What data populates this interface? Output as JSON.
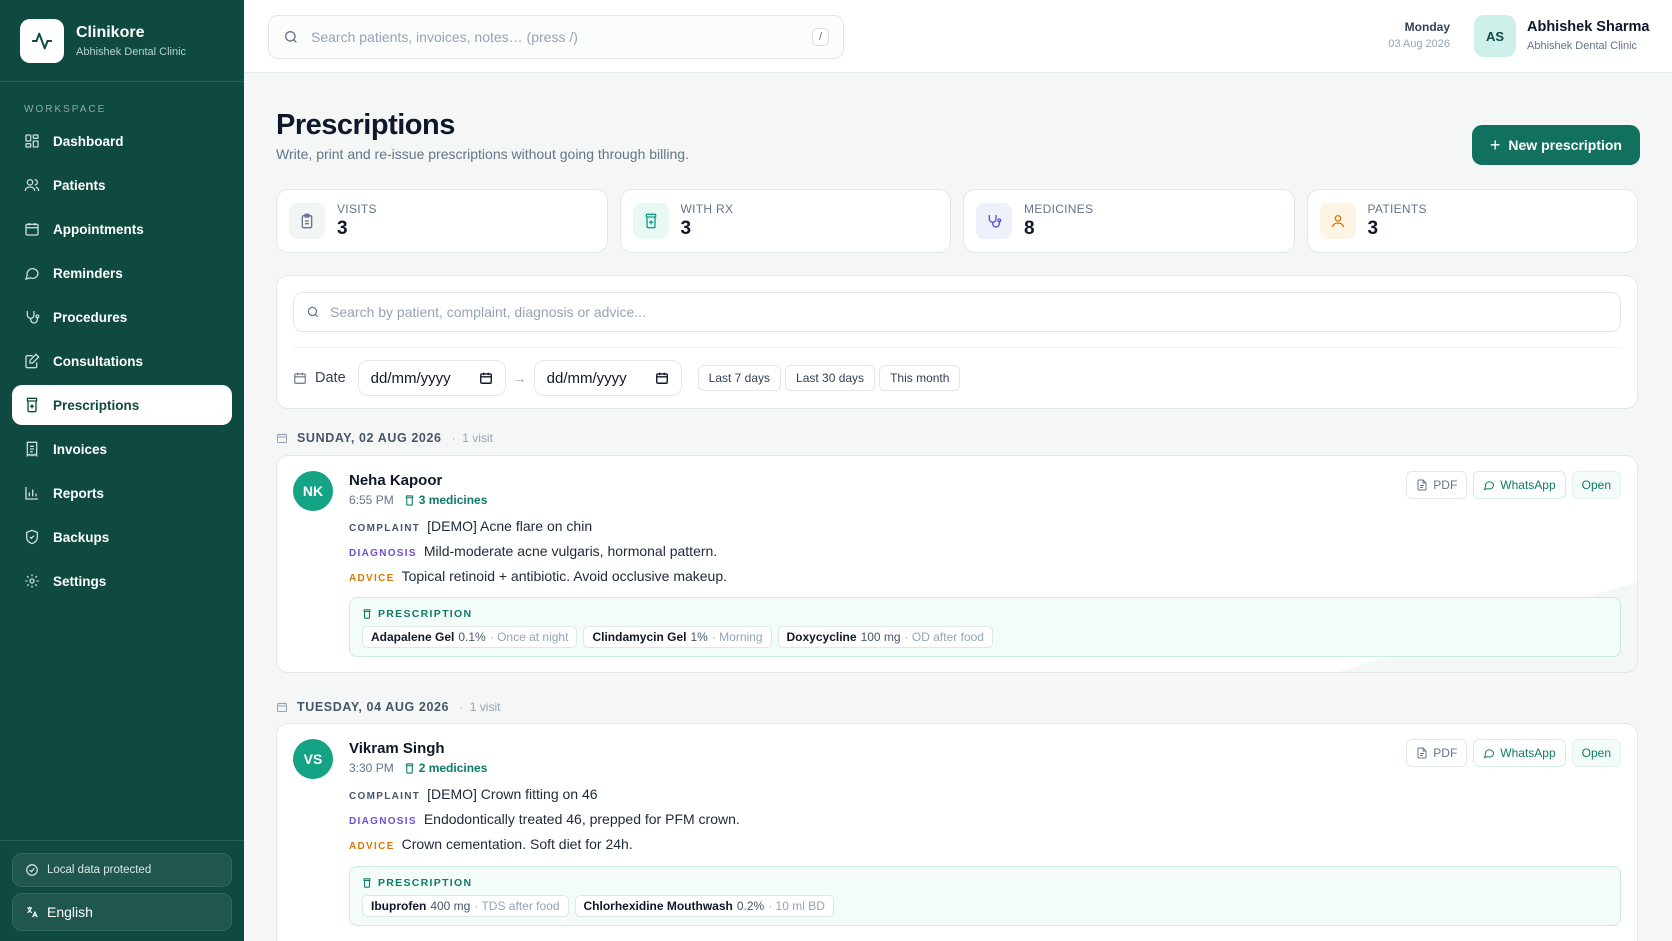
{
  "app": {
    "name": "Clinikore",
    "clinic": "Abhishek Dental Clinic"
  },
  "sidebar": {
    "section_label": "WORKSPACE",
    "items": [
      {
        "label": "Dashboard",
        "icon": "dashboard-icon"
      },
      {
        "label": "Patients",
        "icon": "users-icon"
      },
      {
        "label": "Appointments",
        "icon": "calendar-icon"
      },
      {
        "label": "Reminders",
        "icon": "message-icon"
      },
      {
        "label": "Procedures",
        "icon": "stethoscope-icon"
      },
      {
        "label": "Consultations",
        "icon": "clipboard-edit-icon"
      },
      {
        "label": "Prescriptions",
        "icon": "bottle-icon",
        "active": true
      },
      {
        "label": "Invoices",
        "icon": "receipt-icon"
      },
      {
        "label": "Reports",
        "icon": "bar-chart-icon"
      },
      {
        "label": "Backups",
        "icon": "shield-icon"
      },
      {
        "label": "Settings",
        "icon": "gear-icon"
      }
    ],
    "footer": {
      "protected": "Local data protected",
      "language": "English"
    }
  },
  "topbar": {
    "search_placeholder": "Search patients, invoices, notes…  (press /)",
    "shortcut": "/",
    "day": "Monday",
    "date": "03 Aug 2026",
    "user_initials": "AS",
    "user_name": "Abhishek Sharma",
    "user_clinic": "Abhishek Dental Clinic"
  },
  "page": {
    "title": "Prescriptions",
    "subtitle": "Write, print and re-issue prescriptions without going through billing.",
    "new_button": "New prescription"
  },
  "stats": [
    {
      "label": "VISITS",
      "value": "3",
      "icon": "clipboard-icon",
      "color": "#64748b",
      "bg": "#f1f5f4"
    },
    {
      "label": "WITH RX",
      "value": "3",
      "icon": "bottle-icon",
      "color": "#0e9f84",
      "bg": "#e8f8f3"
    },
    {
      "label": "MEDICINES",
      "value": "8",
      "icon": "stethoscope-icon",
      "color": "#5b4fd1",
      "bg": "#eef0fb"
    },
    {
      "label": "PATIENTS",
      "value": "3",
      "icon": "user-icon",
      "color": "#d97706",
      "bg": "#fdf4e3"
    }
  ],
  "filters": {
    "search_placeholder": "Search by patient, complaint, diagnosis or advice...",
    "date_label": "Date",
    "from_placeholder": "dd/mm/yyyy",
    "to_placeholder": "dd/mm/yyyy",
    "quick": [
      "Last 7 days",
      "Last 30 days",
      "This month"
    ]
  },
  "labels": {
    "complaint": "COMPLAINT",
    "diagnosis": "DIAGNOSIS",
    "advice": "ADVICE",
    "prescription": "PRESCRIPTION",
    "pdf": "PDF",
    "whatsapp": "WhatsApp",
    "open": "Open"
  },
  "groups": [
    {
      "day": "SUNDAY, 02 AUG 2026",
      "count": "1 visit",
      "visit": {
        "initials": "NK",
        "name": "Neha Kapoor",
        "time": "6:55 PM",
        "medicines": "3 medicines",
        "complaint": "[DEMO] Acne flare on chin",
        "diagnosis": "Mild-moderate acne vulgaris, hormonal pattern.",
        "advice": "Topical retinoid + antibiotic. Avoid occlusive makeup.",
        "rx": [
          {
            "name": "Adapalene Gel",
            "dose": "0.1%",
            "instruction": "· Once at night"
          },
          {
            "name": "Clindamycin Gel",
            "dose": "1%",
            "instruction": "· Morning"
          },
          {
            "name": "Doxycycline",
            "dose": "100 mg",
            "instruction": "· OD after food"
          }
        ]
      }
    },
    {
      "day": "TUESDAY, 04 AUG 2026",
      "count": "1 visit",
      "visit": {
        "initials": "VS",
        "name": "Vikram Singh",
        "time": "3:30 PM",
        "medicines": "2 medicines",
        "complaint": "[DEMO] Crown fitting on 46",
        "diagnosis": "Endodontically treated 46, prepped for PFM crown.",
        "advice": "Crown cementation. Soft diet for 24h.",
        "rx": [
          {
            "name": "Ibuprofen",
            "dose": "400 mg",
            "instruction": "· TDS after food"
          },
          {
            "name": "Chlorhexidine Mouthwash",
            "dose": "0.2%",
            "instruction": "· 10 ml BD"
          }
        ]
      }
    }
  ]
}
